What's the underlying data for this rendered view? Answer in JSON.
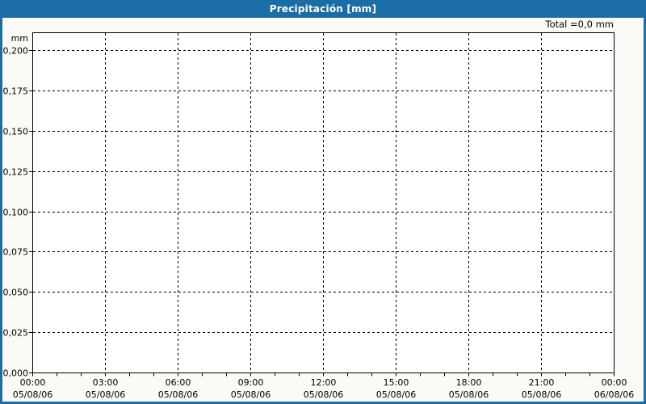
{
  "window": {
    "title": "Precipitación [mm]"
  },
  "chart": {
    "total_text": "Total =0,0 mm",
    "unit_label": "mm"
  },
  "chart_data": {
    "type": "bar",
    "title": "Precipitación [mm]",
    "ylabel": "mm",
    "xlabel": "",
    "ylim": [
      0,
      0.2
    ],
    "y_tick_step": 0.025,
    "y_tick_labels": [
      "0,000",
      "0,025",
      "0,050",
      "0,075",
      "0,100",
      "0,125",
      "0,150",
      "0,175",
      "0,200"
    ],
    "x_tick_labels": [
      {
        "time": "00:00",
        "date": "05/08/06"
      },
      {
        "time": "03:00",
        "date": "05/08/06"
      },
      {
        "time": "06:00",
        "date": "05/08/06"
      },
      {
        "time": "09:00",
        "date": "05/08/06"
      },
      {
        "time": "12:00",
        "date": "05/08/06"
      },
      {
        "time": "15:00",
        "date": "05/08/06"
      },
      {
        "time": "18:00",
        "date": "05/08/06"
      },
      {
        "time": "21:00",
        "date": "05/08/06"
      },
      {
        "time": "00:00",
        "date": "06/08/06"
      }
    ],
    "x_minor_ticks_per_interval": 3,
    "grid": true,
    "grid_style": "dashed",
    "legend_position": "none",
    "series": [],
    "total": "0,0 mm",
    "annotations": [
      "Total =0,0 mm"
    ]
  },
  "colors": {
    "titlebar_bg": "#1B6DA5",
    "frame_border": "#1B6DA5",
    "panel_bg": "#FBFAF6",
    "plot_bg": "#FFFFFF",
    "grid_line": "#000000",
    "axis_line": "#000000",
    "title_text": "#FFFFFF",
    "label_text": "#000000"
  }
}
